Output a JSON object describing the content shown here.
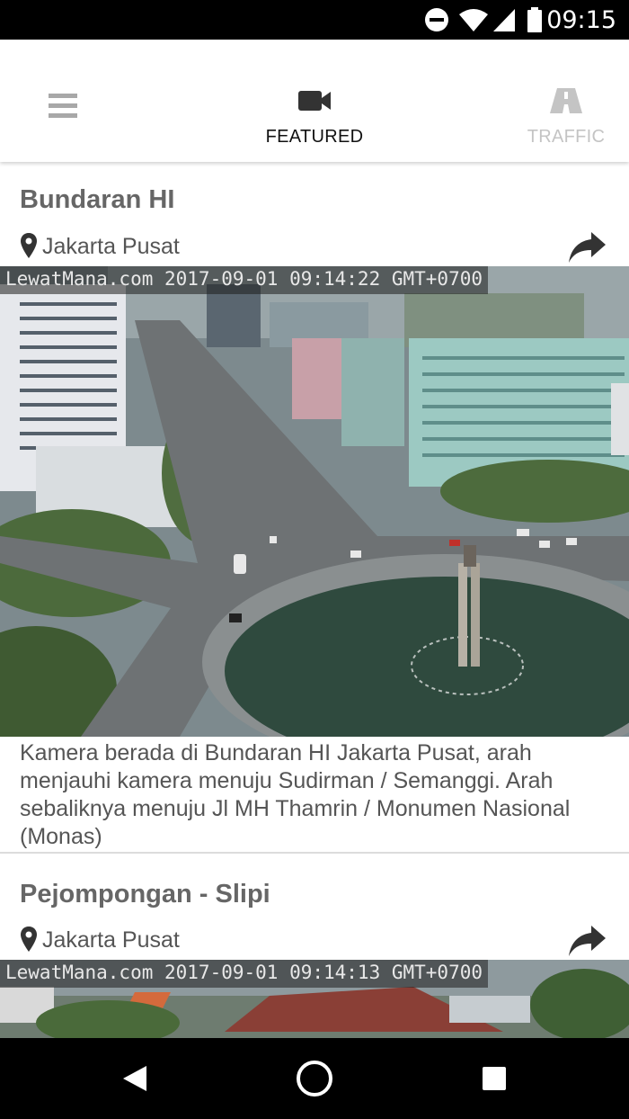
{
  "status_bar": {
    "time": "09:15",
    "icons": [
      "do-not-disturb-icon",
      "wifi-icon",
      "signal-icon",
      "battery-icon"
    ]
  },
  "app_bar": {
    "menu_icon": "hamburger-menu-icon",
    "tabs": [
      {
        "label": "FEATURED",
        "icon": "video-camera-icon",
        "active": true
      },
      {
        "label": "TRAFFIC",
        "icon": "road-icon",
        "active": false
      }
    ]
  },
  "cards": [
    {
      "title": "Bundaran HI",
      "location": "Jakarta Pusat",
      "camera_timestamp": "LewatMana.com 2017-09-01 09:14:22 GMT+0700",
      "description": "Kamera berada di Bundaran HI Jakarta Pusat, arah menjauhi kamera menuju Sudirman / Semanggi. Arah sebaliknya menuju Jl MH Thamrin / Monumen Nasional (Monas)"
    },
    {
      "title": "Pejompongan - Slipi",
      "location": "Jakarta Pusat",
      "camera_timestamp": "LewatMana.com 2017-09-01 09:14:13 GMT+0700"
    }
  ],
  "nav_bar": {
    "icons": [
      "back-icon",
      "home-icon",
      "recents-icon"
    ]
  },
  "colors": {
    "accent_active": "#111111",
    "inactive_tab": "#c4c4c4",
    "title_text": "#666666",
    "body_text": "#555555"
  }
}
